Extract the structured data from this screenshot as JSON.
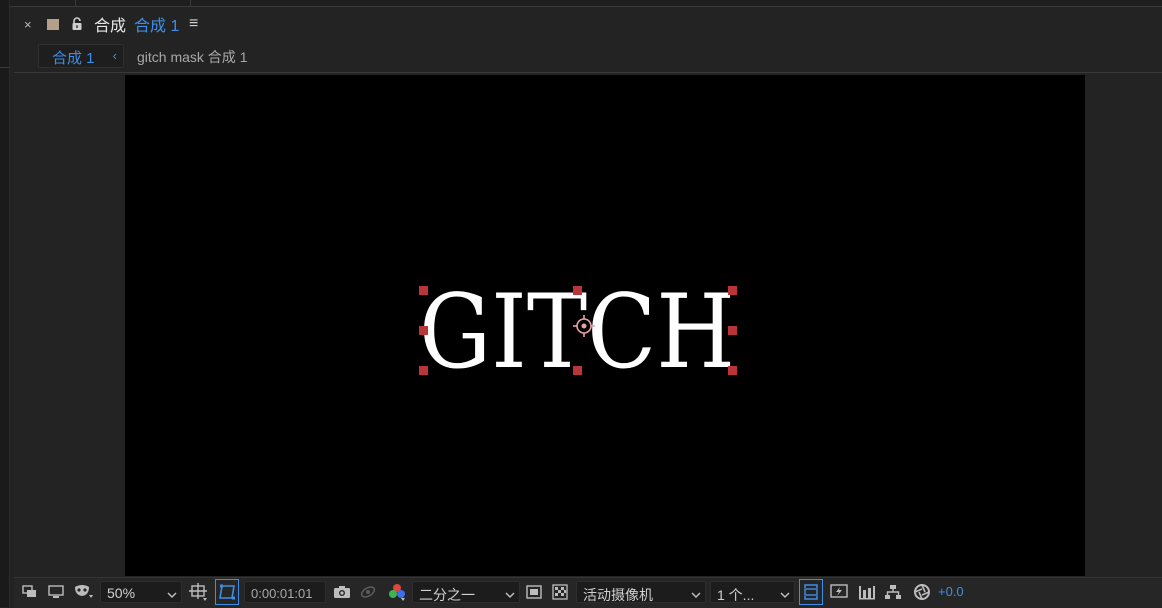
{
  "panel": {
    "close_label": "×",
    "title": "合成",
    "comp_name": "合成 1",
    "menu_label": "≡"
  },
  "breadcrumb": {
    "active": "合成 1",
    "chevron": "‹",
    "next": "gitch mask 合成 1"
  },
  "canvas": {
    "text": "GITCH",
    "background": "#000000",
    "text_color": "#ffffff",
    "handle_color": "#b8363a"
  },
  "bottom_bar": {
    "zoom": "50%",
    "timecode": "0:00:01:01",
    "resolution": "二分之一",
    "camera": "活动摄像机",
    "views": "1 个...",
    "exposure": "+0.0"
  },
  "colors": {
    "accent": "#3d8ee8",
    "panel_bg": "#232323"
  },
  "icons": [
    "close-icon",
    "color-swatch-icon",
    "lock-icon",
    "panel-menu-icon",
    "always-preview-icon",
    "monitor-icon",
    "mask-visibility-icon",
    "region-of-interest-icon",
    "transparency-grid-icon",
    "snapshot-icon",
    "show-snapshot-icon",
    "channel-icon",
    "fast-preview-icon",
    "flowchart-icon",
    "reset-exposure-icon",
    "timeline-icon",
    "draft3d-icon",
    "toggle-mask-icon"
  ]
}
